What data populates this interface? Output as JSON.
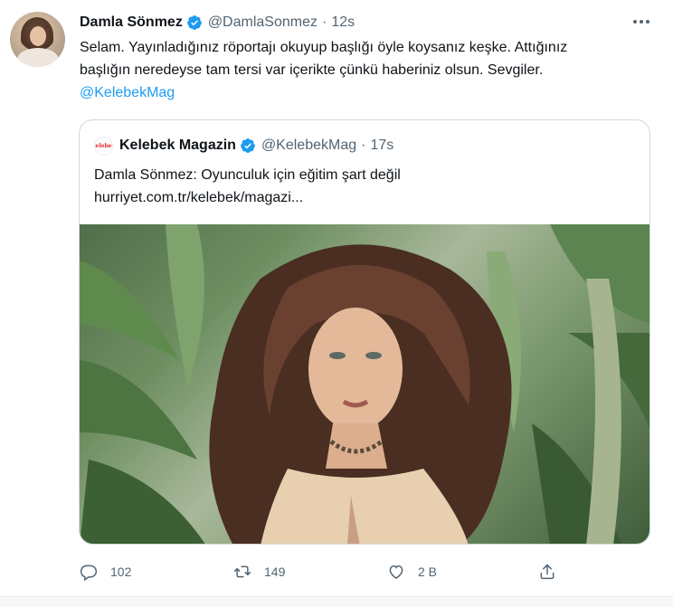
{
  "tweet": {
    "author_name": "Damla Sönmez",
    "handle": "@DamlaSonmez",
    "separator": "·",
    "time": "12s",
    "text_line1": "Selam. Yayınladığınız röportajı okuyup başlığı öyle koysanız keşke. Attığınız",
    "text_line2": "başlığın neredeyse tam tersi var içerikte çünkü haberiniz olsun. Sevgiler.",
    "mention": "@KelebekMag"
  },
  "quote": {
    "logo_text": "kelebek",
    "author_name": "Kelebek Magazin",
    "handle": "@KelebekMag",
    "separator": "·",
    "time": "17s",
    "title": "Damla Sönmez: Oyunculuk için eğitim şart değil",
    "link": "hurriyet.com.tr/kelebek/magazi..."
  },
  "actions": {
    "reply_count": "102",
    "retweet_count": "149",
    "like_count": "2 B"
  },
  "icons": {
    "verified": "verified-badge-icon",
    "more": "more-icon",
    "reply": "reply-icon",
    "retweet": "retweet-icon",
    "like": "heart-icon",
    "share": "share-icon"
  },
  "colors": {
    "accent": "#1d9bf0",
    "secondary_text": "#536471",
    "primary_text": "#0f1419",
    "border": "#cfd9de"
  }
}
